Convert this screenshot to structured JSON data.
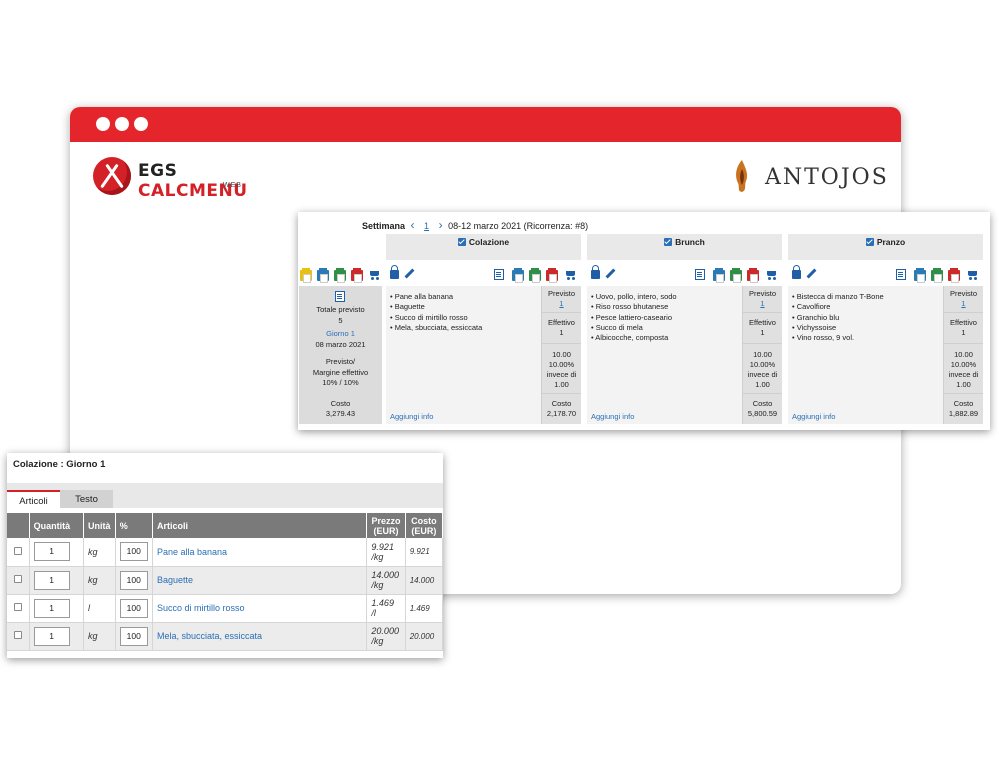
{
  "branding": {
    "egs_part1": "EGS ",
    "egs_part2": "CALCMENU",
    "egs_sub": "WEB",
    "antojos": "ANTOJOS"
  },
  "colors": {
    "brand_red": "#e4252b",
    "link_blue": "#2a6fb5",
    "printer_yellow": "#e8c012",
    "printer_blue": "#2a7ab5",
    "printer_green": "#2f8f46",
    "printer_red": "#cc2a2a"
  },
  "planner": {
    "week_label": "Settimana",
    "week_number": "1",
    "week_range": "08-12 marzo 2021 (Ricorrenza: #8)",
    "day": {
      "totale_label": "Totale previsto",
      "totale_value": "5",
      "giorno_link": "Giorno 1",
      "date": "08 marzo 2021",
      "margine_label1": "Previsto/",
      "margine_label2": "Margine effettivo",
      "margine_value": "10% / 10%",
      "costo_label": "Costo",
      "costo_value": "3,279.43"
    },
    "meals": [
      {
        "name": "Colazione",
        "items": [
          "• Pane alla banana",
          "• Baguette",
          "• Succo di mirtillo rosso",
          "• Mela, sbucciata, essiccata"
        ],
        "previsto_label": "Previsto",
        "previsto_value": "1",
        "effettivo_label": "Effettivo",
        "effettivo_value": "1",
        "stats": [
          "10.00",
          "10.00%",
          "invece di",
          "1.00"
        ],
        "costo_label": "Costo",
        "costo_value": "2,178.70",
        "add_info": "Aggiungi info"
      },
      {
        "name": "Brunch",
        "items": [
          "• Uovo, pollo, intero, sodo",
          "• Riso rosso bhutanese",
          "• Pesce lattiero-caseario",
          "• Succo di mela",
          "• Albicocche, composta"
        ],
        "previsto_label": "Previsto",
        "previsto_value": "1",
        "effettivo_label": "Effettivo",
        "effettivo_value": "1",
        "stats": [
          "10.00",
          "10.00%",
          "invece di",
          "1.00"
        ],
        "costo_label": "Costo",
        "costo_value": "5,800.59",
        "add_info": "Aggiungi info"
      },
      {
        "name": "Pranzo",
        "items": [
          "• Bistecca di manzo T-Bone",
          "• Cavolfiore",
          "• Granchio blu",
          "• Vichyssoise",
          "• Vino rosso, 9 vol."
        ],
        "previsto_label": "Previsto",
        "previsto_value": "1",
        "effettivo_label": "Effettivo",
        "effettivo_value": "1",
        "stats": [
          "10.00",
          "10.00%",
          "invece di",
          "1.00"
        ],
        "costo_label": "Costo",
        "costo_value": "1,882.89",
        "add_info": "Aggiungi info"
      }
    ]
  },
  "popup": {
    "title": "Colazione : Giorno 1",
    "tabs": [
      "Articoli",
      "Testo"
    ],
    "headers": {
      "quantita": "Quantità",
      "unita": "Unità",
      "pct": "%",
      "articoli": "Articoli",
      "prezzo1": "Prezzo",
      "prezzo2": "(EUR)",
      "costo1": "Costo",
      "costo2": "(EUR)"
    },
    "rows": [
      {
        "qty": "1",
        "unit": "kg",
        "pct": "100",
        "name": "Pane alla banana",
        "price1": "9.921",
        "price2": "/kg",
        "cost": "9.921"
      },
      {
        "qty": "1",
        "unit": "kg",
        "pct": "100",
        "name": "Baguette",
        "price1": "14.000",
        "price2": "/kg",
        "cost": "14.000"
      },
      {
        "qty": "1",
        "unit": "l",
        "pct": "100",
        "name": "Succo di mirtillo rosso",
        "price1": "1.469",
        "price2": "/l",
        "cost": "1.469"
      },
      {
        "qty": "1",
        "unit": "kg",
        "pct": "100",
        "name": "Mela, sbucciata, essiccata",
        "price1": "20.000",
        "price2": "/kg",
        "cost": "20.000"
      }
    ]
  }
}
